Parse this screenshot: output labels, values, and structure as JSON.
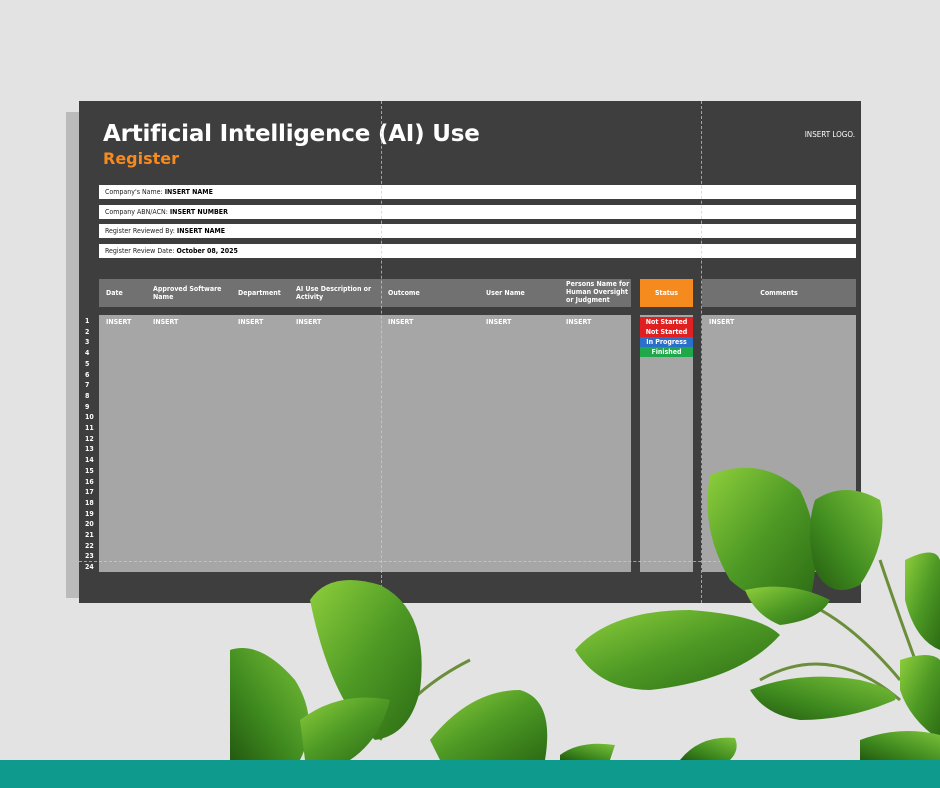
{
  "document": {
    "title": "Artificial Intelligence (AI) Use",
    "subtitle": "Register",
    "logo_text": "INSERT LOGO."
  },
  "info_rows": [
    {
      "label": "Company's Name: ",
      "value": "INSERT NAME"
    },
    {
      "label": "Company ABN/ACN: ",
      "value": "INSERT NUMBER"
    },
    {
      "label": "Register Reviewed By: ",
      "value": "INSERT NAME"
    },
    {
      "label": "Register Review Date: ",
      "value": "October 08, 2025"
    }
  ],
  "table": {
    "columns": [
      "Date",
      "Approved Software Name",
      "Department",
      "AI Use Description or Activity",
      "Outcome",
      "User Name",
      "Persons Name for Human Oversight or Judgment"
    ],
    "status_header": "Status",
    "comments_header": "Comments",
    "first_row": [
      "INSERT",
      "INSERT",
      "INSERT",
      "INSERT",
      "INSERT",
      "INSERT",
      "INSERT"
    ],
    "first_row_comment": "INSERT",
    "row_numbers": [
      "1",
      "2",
      "3",
      "4",
      "5",
      "6",
      "7",
      "8",
      "9",
      "10",
      "11",
      "12",
      "13",
      "14",
      "15",
      "16",
      "17",
      "18",
      "19",
      "20",
      "21",
      "22",
      "23",
      "24"
    ]
  },
  "status_options": [
    {
      "label": "Not Started",
      "color": "#e02020"
    },
    {
      "label": "Not Started",
      "color": "#e02020"
    },
    {
      "label": "In Progress",
      "color": "#2a6fc9"
    },
    {
      "label": "Finished",
      "color": "#1ea84a"
    }
  ],
  "colors": {
    "sheet_bg": "#3e3e3e",
    "accent_orange": "#f58a1f",
    "footer_teal": "#0f9a8e"
  }
}
